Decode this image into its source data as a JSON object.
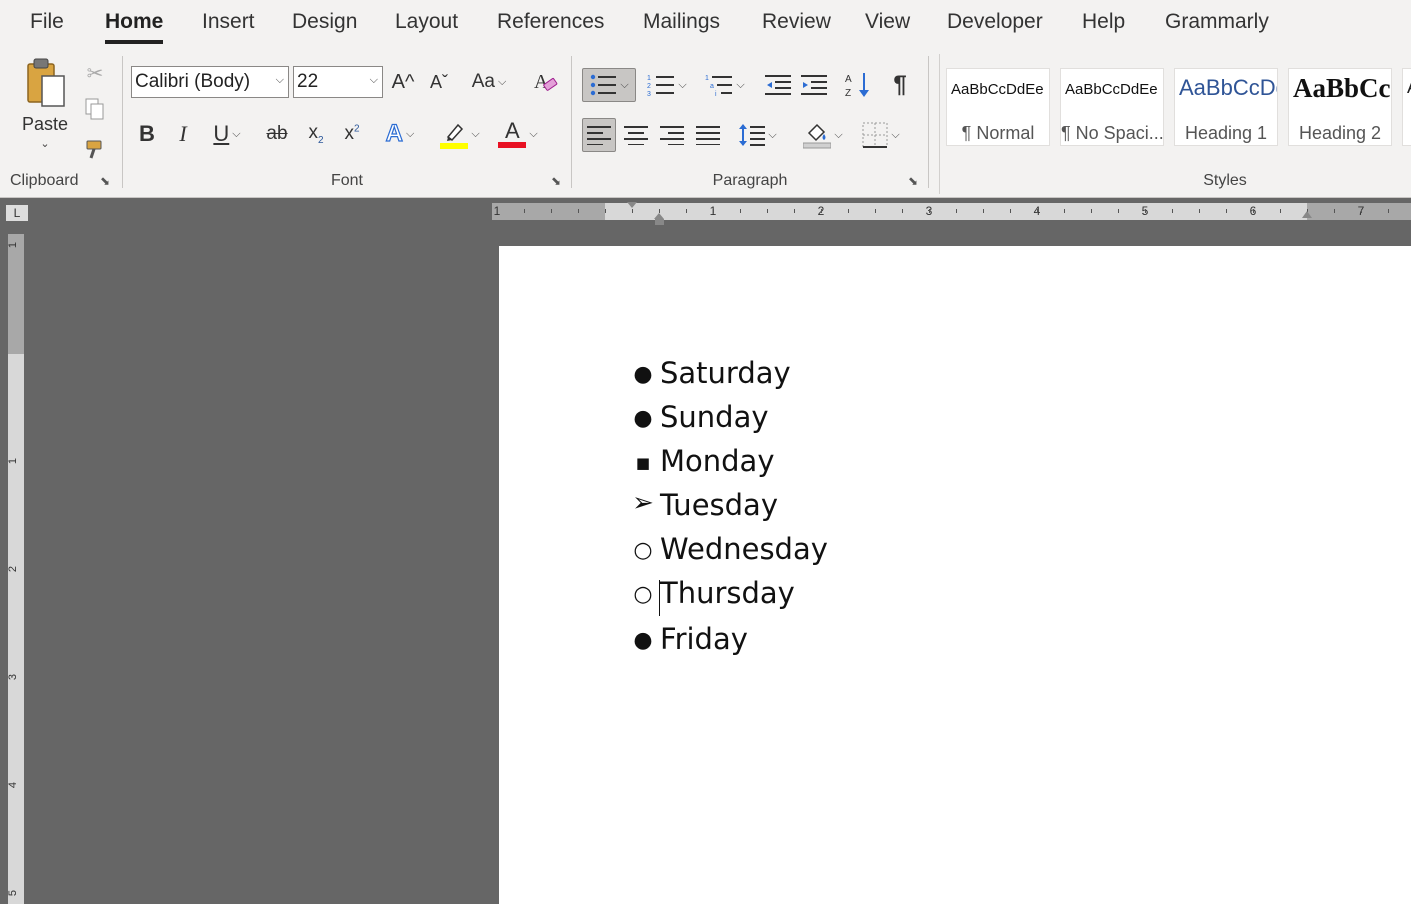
{
  "tabs": [
    {
      "label": "File"
    },
    {
      "label": "Home"
    },
    {
      "label": "Insert"
    },
    {
      "label": "Design"
    },
    {
      "label": "Layout"
    },
    {
      "label": "References"
    },
    {
      "label": "Mailings"
    },
    {
      "label": "Review"
    },
    {
      "label": "View"
    },
    {
      "label": "Developer"
    },
    {
      "label": "Help"
    },
    {
      "label": "Grammarly"
    }
  ],
  "active_tab": "Home",
  "ribbon": {
    "clipboard": {
      "label": "Clipboard",
      "paste_label": "Paste",
      "icons": [
        "paste-icon",
        "cut-icon",
        "copy-icon",
        "format-painter-icon"
      ]
    },
    "font": {
      "label": "Font",
      "font_name": "Calibri (Body)",
      "font_size": "22",
      "bold_glyph": "B",
      "italic_glyph": "I",
      "underline_glyph": "U",
      "strike_glyph": "ab",
      "grow_glyph": "A^",
      "shrink_glyph": "Aˇ",
      "case_glyph": "Aa",
      "font_color_glyph": "A",
      "text_effects_glyph": "A",
      "highlight_color": "#ffff00",
      "font_color": "#e81123"
    },
    "paragraph": {
      "label": "Paragraph",
      "pilcrow_glyph": "¶",
      "bullets_pressed": true,
      "align_left_pressed": true
    },
    "styles": {
      "label": "Styles",
      "items": [
        {
          "sample": "AaBbCcDdEe",
          "name": "¶ Normal"
        },
        {
          "sample": "AaBbCcDdEe",
          "name": "¶ No Spaci..."
        },
        {
          "sample": "AaBbCcDd",
          "name": "Heading 1"
        },
        {
          "sample": "AaBbCc",
          "name": "Heading 2"
        },
        {
          "sample": "A",
          "name": ""
        }
      ]
    }
  },
  "ruler": {
    "corner_glyph": "L",
    "h_labels": [
      "1",
      "1",
      "2",
      "3",
      "4",
      "5",
      "6",
      "7"
    ],
    "v_labels": [
      "1",
      "1",
      "2",
      "3",
      "4",
      "5"
    ]
  },
  "document": {
    "list": [
      {
        "bullet": "●",
        "text": "Saturday"
      },
      {
        "bullet": "●",
        "text": "Sunday"
      },
      {
        "bullet": "■",
        "text": "Monday"
      },
      {
        "bullet": "➢",
        "text": "Tuesday"
      },
      {
        "bullet": "○",
        "text": "Wednesday"
      },
      {
        "bullet": "○",
        "text": "Thursday"
      },
      {
        "bullet": "●",
        "text": "Friday"
      }
    ],
    "cursor_item": "Thursday"
  }
}
